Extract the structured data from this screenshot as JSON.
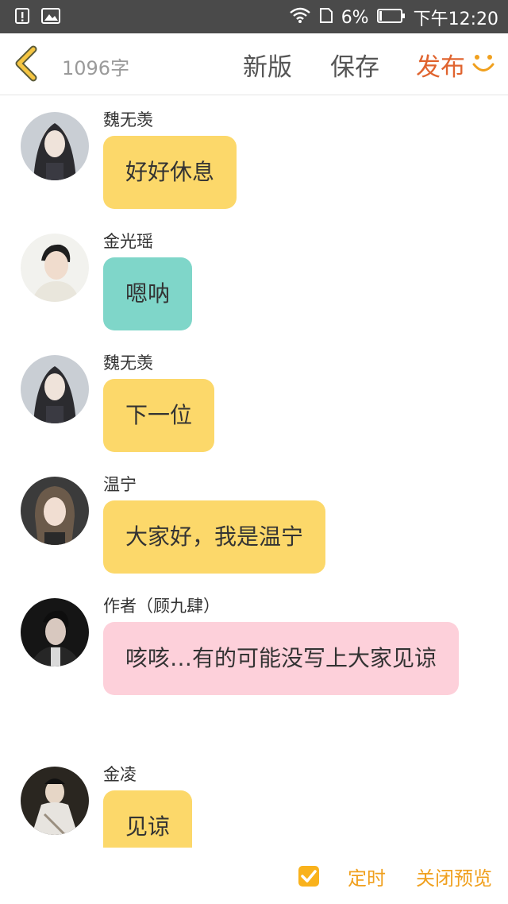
{
  "status_bar": {
    "battery_percent": "6%",
    "time": "下午12:20",
    "icons": [
      "alert-icon",
      "image-icon",
      "wifi-icon",
      "sim-icon",
      "battery-icon"
    ]
  },
  "topbar": {
    "word_count": "1096字",
    "new_version": "新版",
    "save": "保存",
    "publish": "发布",
    "accent_color": "#e0642f"
  },
  "messages": [
    {
      "sender": "魏无羡",
      "text": "好好休息",
      "color": "yellow"
    },
    {
      "sender": "金光瑶",
      "text": "嗯呐",
      "color": "teal"
    },
    {
      "sender": "魏无羡",
      "text": "下一位",
      "color": "yellow"
    },
    {
      "sender": "温宁",
      "text": "大家好，我是温宁",
      "color": "yellow"
    },
    {
      "sender": "作者（顾九肆）",
      "text": "咳咳…有的可能没写上大家见谅",
      "color": "pink"
    },
    {
      "sender": "金凌",
      "text": "见谅",
      "color": "yellow"
    }
  ],
  "bottom": {
    "timer_checked": true,
    "timer": "定时",
    "close_preview": "关闭预览",
    "accent_color": "#f0a01e"
  }
}
